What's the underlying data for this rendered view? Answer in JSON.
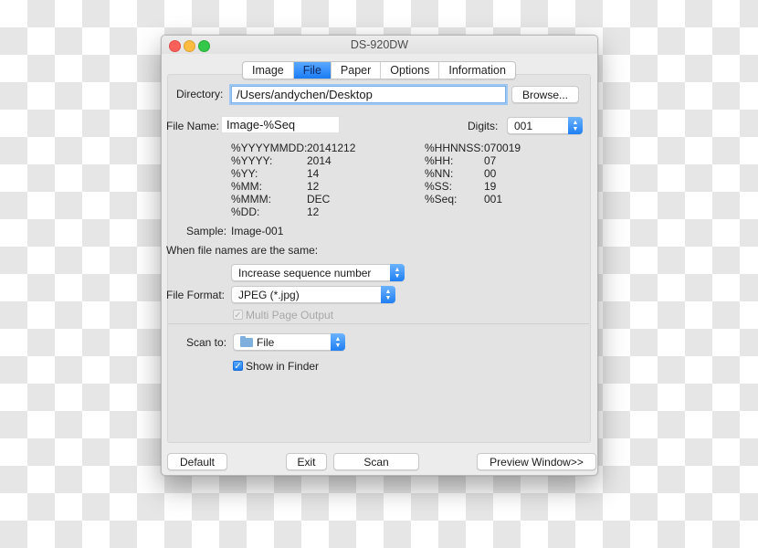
{
  "window": {
    "title": "DS-920DW"
  },
  "tabs": [
    {
      "label": "Image",
      "active": false
    },
    {
      "label": "File",
      "active": true
    },
    {
      "label": "Paper",
      "active": false
    },
    {
      "label": "Options",
      "active": false
    },
    {
      "label": "Information",
      "active": false
    }
  ],
  "directory": {
    "label": "Directory:",
    "value": "/Users/andychen/Desktop",
    "browse_label": "Browse..."
  },
  "file_name": {
    "label": "File Name:",
    "value": "Image-%Seq"
  },
  "digits": {
    "label": "Digits:",
    "value": "001"
  },
  "variables_left": [
    {
      "key": "%YYYYMMDD:",
      "value": "20141212"
    },
    {
      "key": "%YYYY:",
      "value": "2014"
    },
    {
      "key": "%YY:",
      "value": "14"
    },
    {
      "key": "%MM:",
      "value": "12"
    },
    {
      "key": "%MMM:",
      "value": "DEC"
    },
    {
      "key": "%DD:",
      "value": "12"
    }
  ],
  "variables_right": [
    {
      "key": "%HHNNSS:",
      "value": "070019"
    },
    {
      "key": "%HH:",
      "value": "07"
    },
    {
      "key": "%NN:",
      "value": "00"
    },
    {
      "key": "%SS:",
      "value": "19"
    },
    {
      "key": "%Seq:",
      "value": "001"
    }
  ],
  "sample": {
    "label": "Sample:",
    "value": "Image-001"
  },
  "same_names": {
    "label": "When file names are the same:",
    "value": "Increase sequence number"
  },
  "file_format": {
    "label": "File Format:",
    "value": "JPEG (*.jpg)"
  },
  "multi_page": {
    "label": "Multi Page Output",
    "checked": true,
    "enabled": false
  },
  "scan_to": {
    "label": "Scan to:",
    "value": "File",
    "icon": "folder-icon"
  },
  "show_in_finder": {
    "label": "Show in Finder",
    "checked": true
  },
  "footer": {
    "default_label": "Default",
    "exit_label": "Exit",
    "scan_label": "Scan",
    "preview_label": "Preview Window>>"
  },
  "colors": {
    "accent": "#1f7ff4",
    "close": "#fc605b",
    "minimize": "#fdbc40",
    "zoom": "#34c84a"
  }
}
